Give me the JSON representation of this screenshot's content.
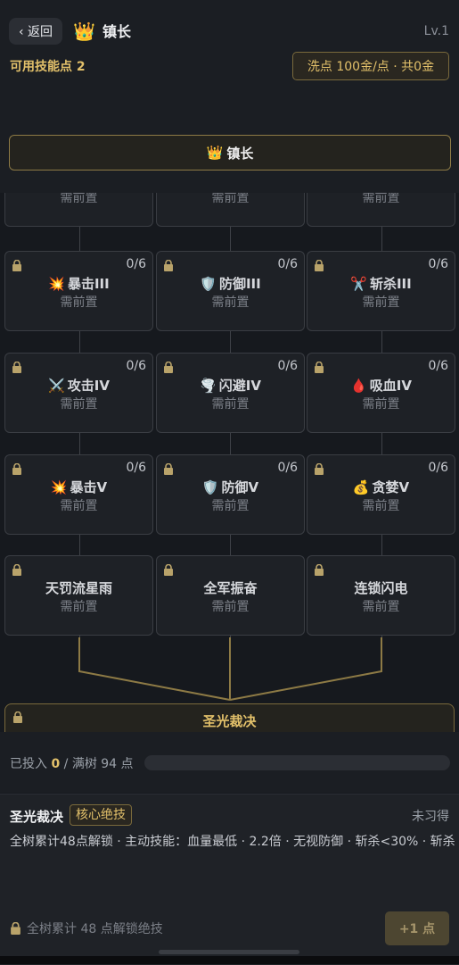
{
  "header": {
    "back_label": "‹ 返回",
    "crown_icon": "👑",
    "title": "镇长",
    "level": "Lv.1",
    "points_label": "可用技能点 2",
    "respec_label": "洗点 100金/点 · 共0金"
  },
  "tree": {
    "root_label": "镇长",
    "root_icon": "👑",
    "partial_row": [
      "需前置",
      "需前置",
      "需前置"
    ],
    "rows": [
      [
        {
          "icon": "💥",
          "name": "暴击III",
          "count": "0/6",
          "req": "需前置"
        },
        {
          "icon": "🛡️",
          "name": "防御III",
          "count": "0/6",
          "req": "需前置"
        },
        {
          "icon": "✂️",
          "name": "斩杀III",
          "count": "0/6",
          "req": "需前置"
        }
      ],
      [
        {
          "icon": "⚔️",
          "name": "攻击IV",
          "count": "0/6",
          "req": "需前置"
        },
        {
          "icon": "🌪️",
          "name": "闪避IV",
          "count": "0/6",
          "req": "需前置"
        },
        {
          "icon": "🩸",
          "name": "吸血IV",
          "count": "0/6",
          "req": "需前置"
        }
      ],
      [
        {
          "icon": "💥",
          "name": "暴击V",
          "count": "0/6",
          "req": "需前置"
        },
        {
          "icon": "🛡️",
          "name": "防御V",
          "count": "0/6",
          "req": "需前置"
        },
        {
          "icon": "💰",
          "name": "贪婪V",
          "count": "0/6",
          "req": "需前置"
        }
      ],
      [
        {
          "icon": "",
          "name": "天罚流星雨",
          "count": "",
          "req": "需前置"
        },
        {
          "icon": "",
          "name": "全军振奋",
          "count": "",
          "req": "需前置"
        },
        {
          "icon": "",
          "name": "连锁闪电",
          "count": "",
          "req": "需前置"
        }
      ]
    ],
    "ultimate_name": "圣光裁决"
  },
  "progress": {
    "label_prefix": "已投入",
    "invested": "0",
    "label_suffix": "/ 满树 94 点",
    "fraction": 0
  },
  "detail": {
    "title": "圣光裁决",
    "badge": "核心绝技",
    "status": "未习得",
    "description": "全树累计48点解锁 · 主动技能：血量最低 · 2.2倍 · 无视防御 · 斩杀<30% · 斩杀",
    "hint": "全树累计 48 点解锁绝技",
    "add_button": "+1 点"
  },
  "colors": {
    "accent_gold": "#e2c06a",
    "background": "#16191e"
  }
}
